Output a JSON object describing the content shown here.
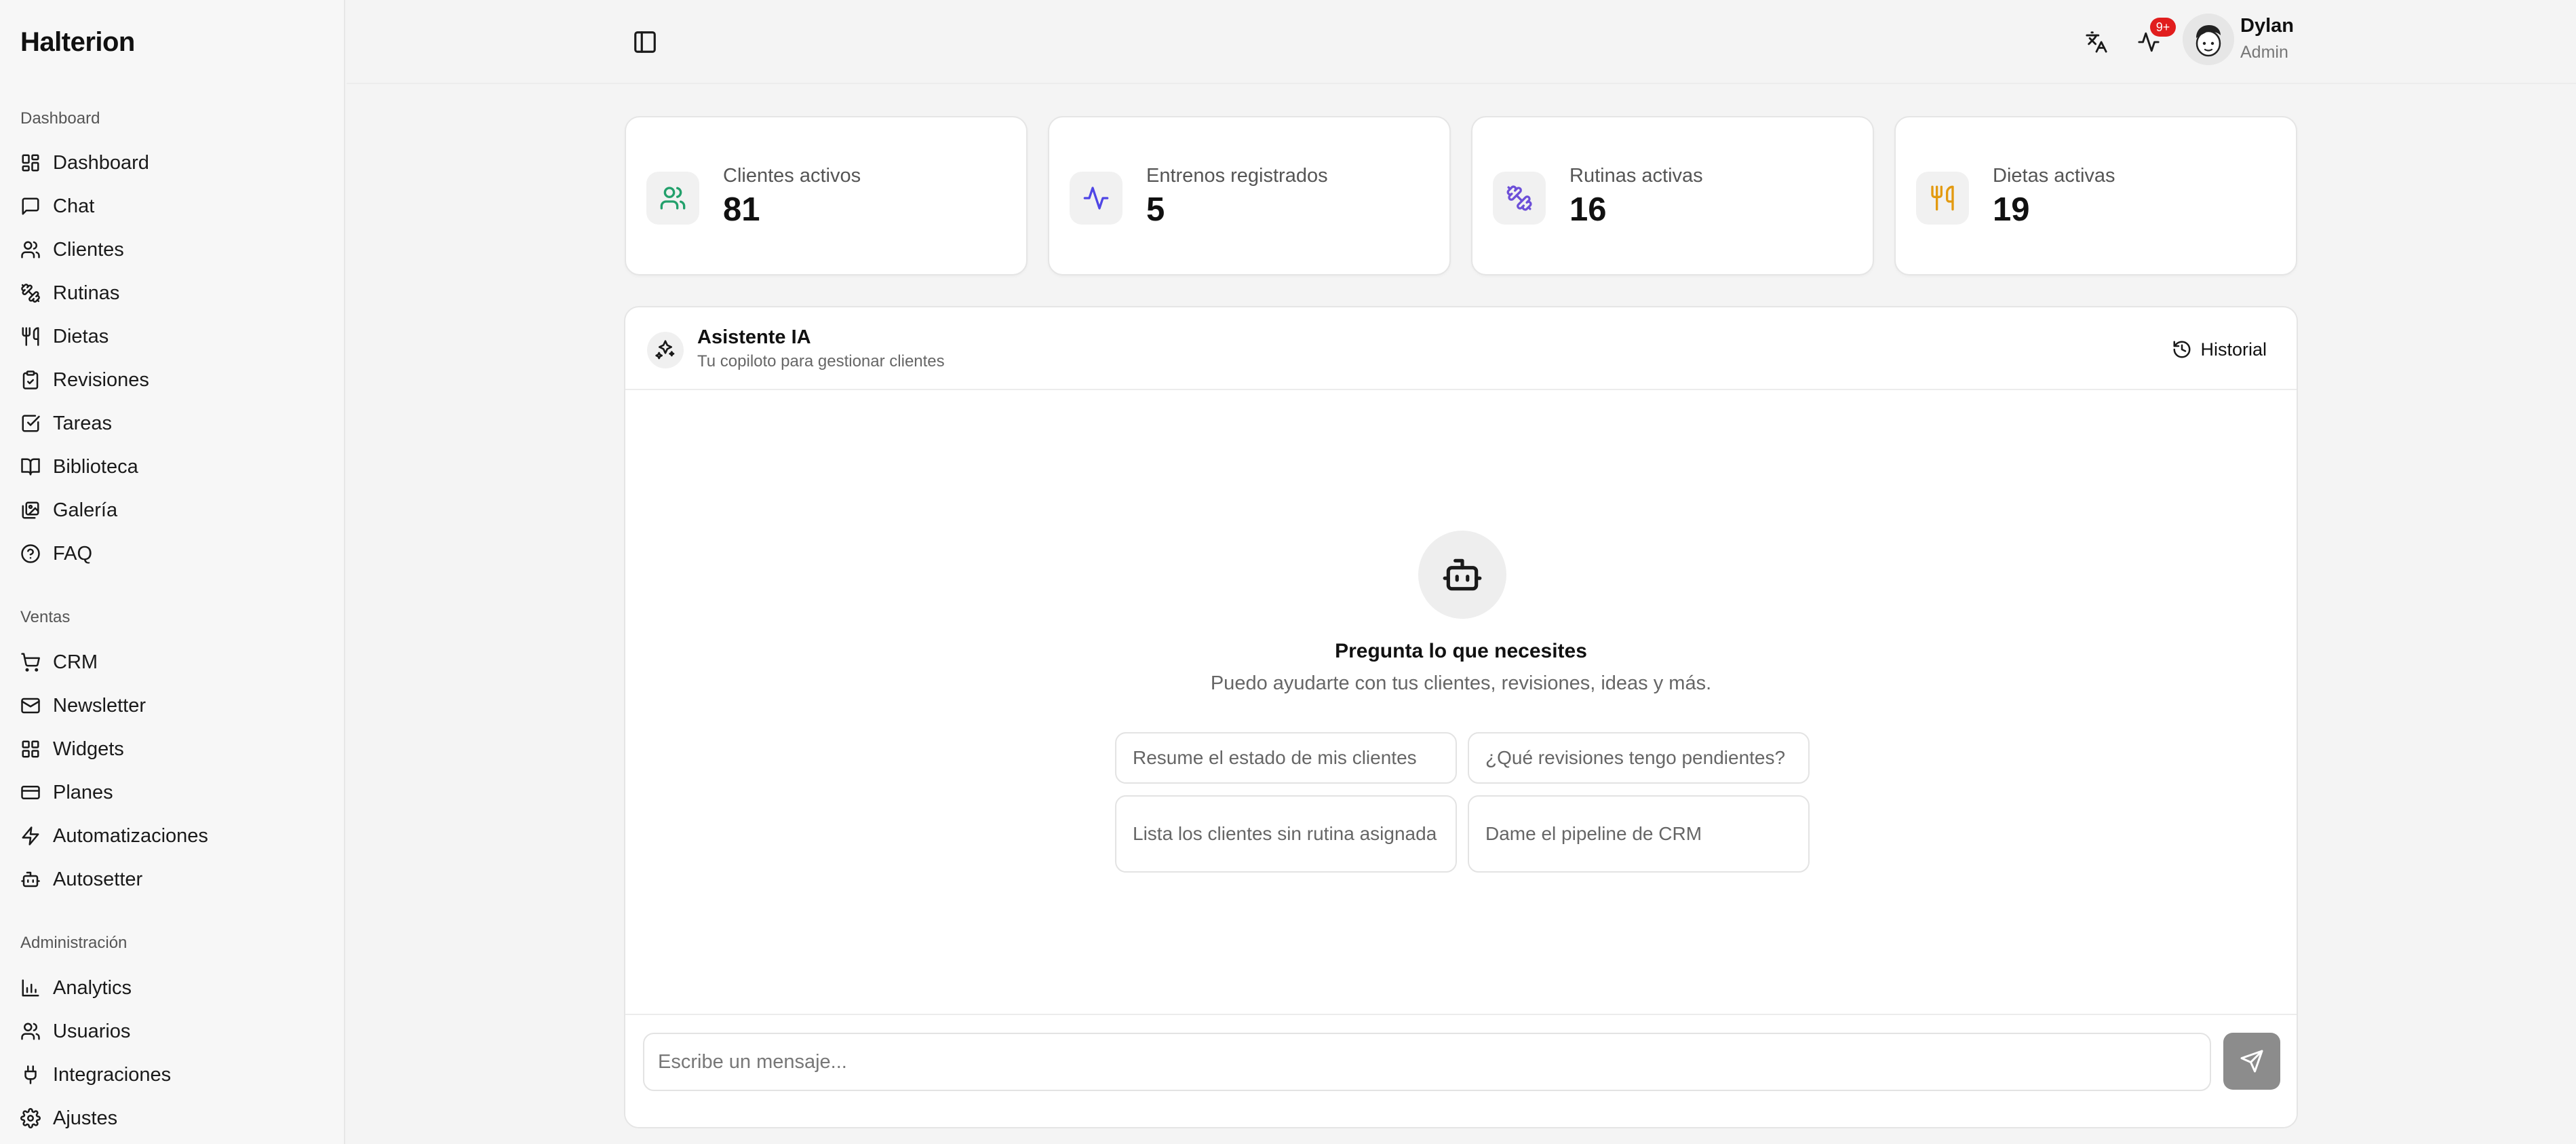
{
  "app": {
    "brand": "Halterion"
  },
  "sidebar": {
    "sections": [
      {
        "title": "Dashboard",
        "items": [
          {
            "label": "Dashboard",
            "icon": "dashboard-grid-icon"
          },
          {
            "label": "Chat",
            "icon": "message-square-icon"
          },
          {
            "label": "Clientes",
            "icon": "users-icon"
          },
          {
            "label": "Rutinas",
            "icon": "dumbbell-icon"
          },
          {
            "label": "Dietas",
            "icon": "utensils-icon"
          },
          {
            "label": "Revisiones",
            "icon": "clipboard-check-icon"
          },
          {
            "label": "Tareas",
            "icon": "check-square-icon"
          },
          {
            "label": "Biblioteca",
            "icon": "book-open-icon"
          },
          {
            "label": "Galería",
            "icon": "images-icon"
          },
          {
            "label": "FAQ",
            "icon": "help-circle-icon"
          }
        ]
      },
      {
        "title": "Ventas",
        "items": [
          {
            "label": "CRM",
            "icon": "shopping-cart-icon"
          },
          {
            "label": "Newsletter",
            "icon": "mail-icon"
          },
          {
            "label": "Widgets",
            "icon": "widgets-grid-icon"
          },
          {
            "label": "Planes",
            "icon": "credit-card-icon"
          },
          {
            "label": "Automatizaciones",
            "icon": "zap-icon"
          },
          {
            "label": "Autosetter",
            "icon": "bot-icon"
          }
        ]
      },
      {
        "title": "Administración",
        "items": [
          {
            "label": "Analytics",
            "icon": "bar-chart-icon"
          },
          {
            "label": "Usuarios",
            "icon": "users-icon"
          },
          {
            "label": "Integraciones",
            "icon": "plug-icon"
          },
          {
            "label": "Ajustes",
            "icon": "settings-icon"
          }
        ]
      }
    ]
  },
  "header": {
    "notification_badge": "9+",
    "user": {
      "name": "Dylan",
      "role": "Admin"
    }
  },
  "stats": [
    {
      "label": "Clientes activos",
      "value": "81",
      "icon": "users-icon",
      "color": "#22a06b"
    },
    {
      "label": "Entrenos registrados",
      "value": "5",
      "icon": "activity-icon",
      "color": "#4f46e5"
    },
    {
      "label": "Rutinas activas",
      "value": "16",
      "icon": "dumbbell-icon",
      "color": "#6d4fd8"
    },
    {
      "label": "Dietas activas",
      "value": "19",
      "icon": "utensils-icon",
      "color": "#e39a10"
    }
  ],
  "assistant": {
    "title": "Asistente IA",
    "subtitle": "Tu copiloto para gestionar clientes",
    "history_label": "Historial",
    "empty_title": "Pregunta lo que necesites",
    "empty_subtitle": "Puedo ayudarte con tus clientes, revisiones, ideas y más.",
    "suggestions": [
      "Resume el estado de mis clientes",
      "¿Qué revisiones tengo pendientes?",
      "Lista los clientes sin rutina asignada",
      "Dame el pipeline de CRM"
    ],
    "input_placeholder": "Escribe un mensaje..."
  },
  "colors": {
    "send_button": "#8c8c8c",
    "badge": "#e11d1d"
  }
}
